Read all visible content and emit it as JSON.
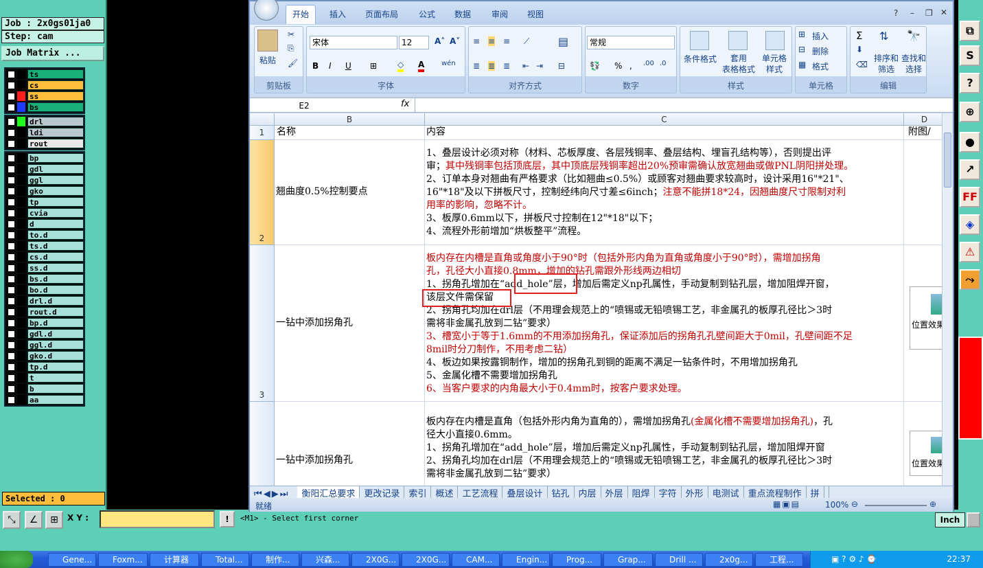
{
  "cam": {
    "job_label": "Job : 2x0gs01ja0",
    "step_label": "Step: cam",
    "job_matrix_label": "Job Matrix ...",
    "layers_group1": [
      {
        "name": "ts",
        "color": "#000000",
        "bg": "#18b078"
      },
      {
        "name": "cs",
        "color": "#000000",
        "bg": "#ffbd3c"
      },
      {
        "name": "ss",
        "color": "#ff1e1e",
        "bg": "#ffbd3c"
      },
      {
        "name": "bs",
        "color": "#1e3cff",
        "bg": "#18b078"
      }
    ],
    "layers_group2": [
      "drl",
      "ldi",
      "rout"
    ],
    "layers_group3": [
      "bp",
      "gdl",
      "ggl",
      "gko",
      "tp",
      "cvia",
      "d",
      "to.d",
      "ts.d",
      "cs.d",
      "ss.d",
      "bs.d",
      "bo.d",
      "drl.d",
      "rout.d",
      "bp.d",
      "gdl.d",
      "ggl.d",
      "gko.d",
      "tp.d",
      "t",
      "b",
      "aa"
    ],
    "selected_label": "Selected : 0",
    "xy_label": "X Y :",
    "status_message": "<M1> - Select first corner",
    "units": "Inch"
  },
  "excel": {
    "tabs": [
      "开始",
      "插入",
      "页面布局",
      "公式",
      "数据",
      "审阅",
      "视图"
    ],
    "groups": {
      "clipboard": {
        "title": "剪贴板",
        "paste": "粘贴"
      },
      "font": {
        "title": "字体",
        "font_name": "宋体",
        "font_size": "12"
      },
      "alignment": {
        "title": "对齐方式"
      },
      "number": {
        "title": "数字",
        "format": "常规"
      },
      "styles": {
        "title": "样式",
        "conditional": "条件格式",
        "table": "套用\n表格格式",
        "cell_styles": "单元格\n样式"
      },
      "cells": {
        "title": "单元格",
        "insert": "插入",
        "delete": "删除",
        "format": "格式"
      },
      "editing": {
        "title": "编辑",
        "sort": "排序和\n筛选",
        "find": "查找和\n选择"
      }
    },
    "name_box": "E2",
    "fx": "fx",
    "columns": [
      {
        "id": "B"
      },
      {
        "id": "C"
      },
      {
        "id": "D"
      }
    ],
    "header_row": {
      "num": "1",
      "b": "名称",
      "c": "内容",
      "d": "附图/"
    },
    "rows": [
      {
        "num": "2",
        "name": "翘曲度0.5%控制要点",
        "lines": [
          {
            "t": "1、叠层设计必须对称（材料、芯板厚度、各层残铜率、叠层结构、埋盲孔结构等），否则提出评",
            "red": false
          },
          {
            "t": "审；",
            "red": false,
            "suffix": "其中残铜率包括顶底层，其中顶底层残铜率超出20%预审需确认放宽翘曲或做PNL阴阳拼处理。"
          },
          {
            "t": "2、订单本身对翘曲有严格要求（比如翘曲≤0.5%）或顾客对翘曲要求较高时，设计采用16\"*21\"、",
            "red": false
          },
          {
            "t": "16\"*18\"及以下拼板尺寸，控制经纬向尺寸差≤6inch；",
            "red": false,
            "suffix": "注意不能拼18*24，因翘曲度尺寸限制对利"
          },
          {
            "t": "用率的影响，忽略不计。",
            "red": true
          },
          {
            "t": "3、板厚0.6mm以下，拼板尺寸控制在12\"*18\"以下；",
            "red": false
          },
          {
            "t": "4、流程外形前增加“烘板整平”流程。",
            "red": false
          }
        ]
      },
      {
        "num": "3",
        "name": "一钻中添加拐角孔",
        "lines": [
          {
            "t": "板内存在内槽是直角或角度小于90°时（包括外形内角为直角或角度小于90°时），需增加拐角",
            "red": true
          },
          {
            "t": "孔，孔径大小直接0.8mm，增加的钻孔需跟外形线两边相切",
            "red": true
          },
          {
            "t": "1、拐角孔增加在“add_hole”层，增加后需定义np孔属性，手动复制到钻孔层，增加阻焊开窗，",
            "red": false
          },
          {
            "t": "该层文件需保留",
            "red": false
          },
          {
            "t": "2、拐角孔均加在drl层（不用理会规范上的“喷锡或无铅喷锡工艺，非金属孔的板厚孔径比＞3时",
            "red": false
          },
          {
            "t": "需将非金属孔放到二钻”要求）",
            "red": false
          },
          {
            "t": "3、槽宽小于等于1.6mm的不用添加拐角孔，保证添加后的拐角孔孔壁间距大于0mil，孔壁间距不足",
            "red": true
          },
          {
            "t": "8mil时分刀制作，不用考虑二钻）",
            "red": true
          },
          {
            "t": "4、板边如果按露铜制作，增加的拐角孔到铜的距离不满足一钻条件时，不用增加拐角孔",
            "red": false
          },
          {
            "t": "5、金属化槽不需要增加拐角孔",
            "red": false
          },
          {
            "t": "6、当客户要求的内角最大小于0.4mm时，按客户要求处理。",
            "red": true
          }
        ],
        "image_caption": "位置效果"
      },
      {
        "num": "",
        "name": "一钻中添加拐角孔",
        "lines": [
          {
            "t": "板内存在内槽是直角（包括外形内角为直角的），需增加拐角孔",
            "red": false,
            "suffix": "(金属化槽不需要增加拐角孔)",
            "tail": "，孔"
          },
          {
            "t": "径大小直接0.6mm。",
            "red": false
          },
          {
            "t": "1、拐角孔增加在“add_hole”层，增加后需定义np孔属性，手动复制到钻孔层，增加阻焊开窗",
            "red": false
          },
          {
            "t": "2、拐角孔均加在drl层（不用理会规范上的“喷锡或无铅喷锡工艺，非金属孔的板厚孔径比＞3时",
            "red": false
          },
          {
            "t": "需将非金属孔放到二钻”要求）",
            "red": false
          }
        ],
        "image_caption": "位置效果"
      }
    ],
    "sheets": [
      "衡阳汇总要求",
      "更改记录",
      "索引",
      "概述",
      "工艺流程",
      "叠层设计",
      "钻孔",
      "内层",
      "外层",
      "阻焊",
      "字符",
      "外形",
      "电测试",
      "重点流程制作",
      "拼"
    ],
    "status": "就绪",
    "zoom": "100%"
  },
  "taskbar": {
    "items": [
      "Gene...",
      "Foxm...",
      "计算器",
      "Total...",
      "制作...",
      "兴森...",
      "2X0G...",
      "2X0G...",
      "CAM...",
      "Engin...",
      "Prog...",
      "Grap...",
      "Drill ...",
      "2x0g...",
      "工程..."
    ],
    "clock": "22:37"
  }
}
